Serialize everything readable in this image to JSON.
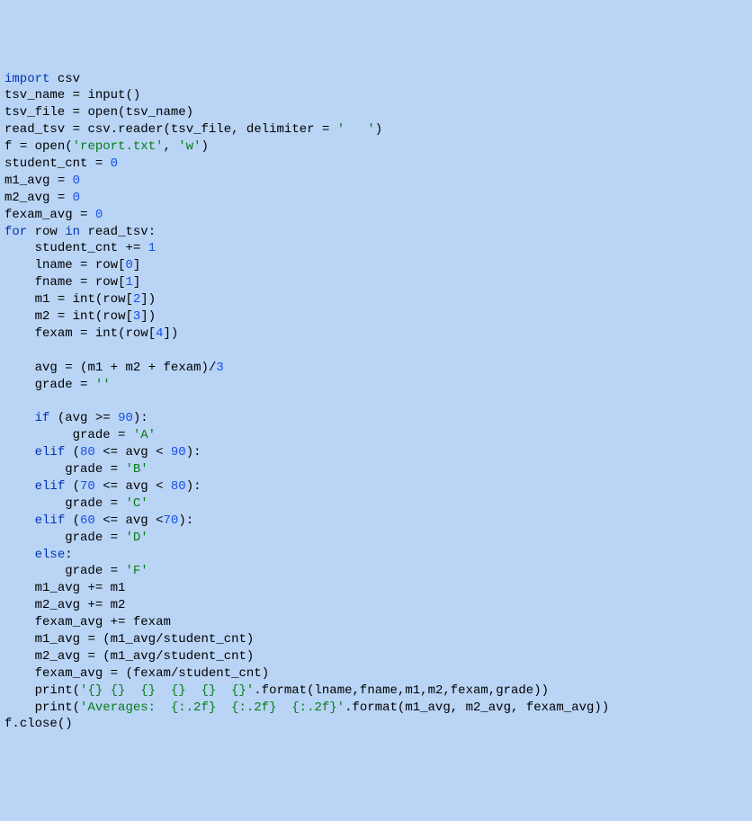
{
  "code": {
    "lines": [
      {
        "raw": "import csv",
        "tokens": [
          [
            "kw",
            "import"
          ],
          [
            "",
            ""
          ],
          [
            "",
            "csv"
          ]
        ]
      },
      {
        "raw": "tsv_name = input()"
      },
      {
        "raw": "tsv_file = open(tsv_name)"
      },
      {
        "raw": "read_tsv = csv.reader(tsv_file, delimiter = '   ')"
      },
      {
        "raw": "f = open('report.txt', 'w')"
      },
      {
        "raw": "student_cnt = 0"
      },
      {
        "raw": "m1_avg = 0"
      },
      {
        "raw": "m2_avg = 0"
      },
      {
        "raw": "fexam_avg = 0"
      },
      {
        "raw": "for row in read_tsv:"
      },
      {
        "raw": "    student_cnt += 1"
      },
      {
        "raw": "    lname = row[0]"
      },
      {
        "raw": "    fname = row[1]"
      },
      {
        "raw": "    m1 = int(row[2])"
      },
      {
        "raw": "    m2 = int(row[3])"
      },
      {
        "raw": "    fexam = int(row[4])"
      },
      {
        "raw": ""
      },
      {
        "raw": "    avg = (m1 + m2 + fexam)/3"
      },
      {
        "raw": "    grade = ''"
      },
      {
        "raw": ""
      },
      {
        "raw": "    if (avg >= 90):"
      },
      {
        "raw": "         grade = 'A'"
      },
      {
        "raw": "    elif (80 <= avg < 90):"
      },
      {
        "raw": "        grade = 'B'"
      },
      {
        "raw": "    elif (70 <= avg < 80):"
      },
      {
        "raw": "        grade = 'C'"
      },
      {
        "raw": "    elif (60 <= avg <70):"
      },
      {
        "raw": "        grade = 'D'"
      },
      {
        "raw": "    else:"
      },
      {
        "raw": "        grade = 'F'"
      },
      {
        "raw": "    m1_avg += m1"
      },
      {
        "raw": "    m2_avg += m2"
      },
      {
        "raw": "    fexam_avg += fexam"
      },
      {
        "raw": "    m1_avg = (m1_avg/student_cnt)"
      },
      {
        "raw": "    m2_avg = (m1_avg/student_cnt)"
      },
      {
        "raw": "    fexam_avg = (fexam/student_cnt)"
      },
      {
        "raw": "    print('{} {}  {}  {}  {}  {}'.format(lname,fname,m1,m2,fexam,grade))"
      },
      {
        "raw": "    print('Averages:  {:.2f}  {:.2f}  {:.2f}'.format(m1_avg, m2_avg, fexam_avg))"
      },
      {
        "raw": "f.close()"
      }
    ]
  },
  "syntax": {
    "keywords": [
      "import",
      "for",
      "in",
      "if",
      "elif",
      "else"
    ],
    "builtins": [
      "input",
      "open",
      "int",
      "print",
      "csv",
      "reader",
      "format",
      "close"
    ],
    "strings_color": "#067d17",
    "numbers_color": "#1750eb",
    "keywords_color": "#0033b3"
  }
}
